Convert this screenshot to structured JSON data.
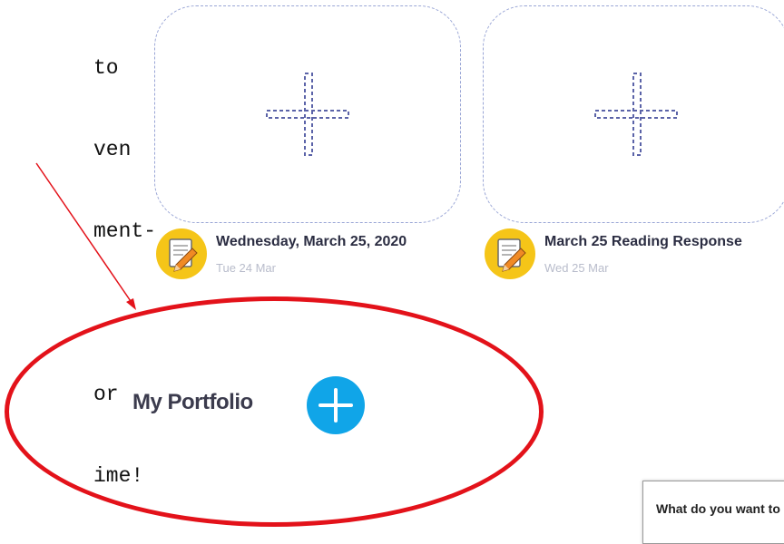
{
  "note": {
    "lines": [
      "to",
      "ven",
      "ment-",
      "",
      "or",
      "ime!"
    ]
  },
  "assignments": [
    {
      "title": "Wednesday, March 25, 2020",
      "date": "Tue 24 Mar",
      "icon": "pencil-notepad-icon"
    },
    {
      "title": "March 25 Reading Response",
      "date": "Wed 25 Mar",
      "icon": "pencil-notepad-icon"
    }
  ],
  "portfolio": {
    "label": "My Portfolio",
    "add_icon": "plus-icon"
  },
  "prompt": {
    "text": "What do you want to"
  },
  "colors": {
    "accent_blue": "#10a5e8",
    "highlight_red": "#e3121a",
    "icon_yellow": "#f5c518",
    "dashed_border": "#9aa6d6"
  }
}
